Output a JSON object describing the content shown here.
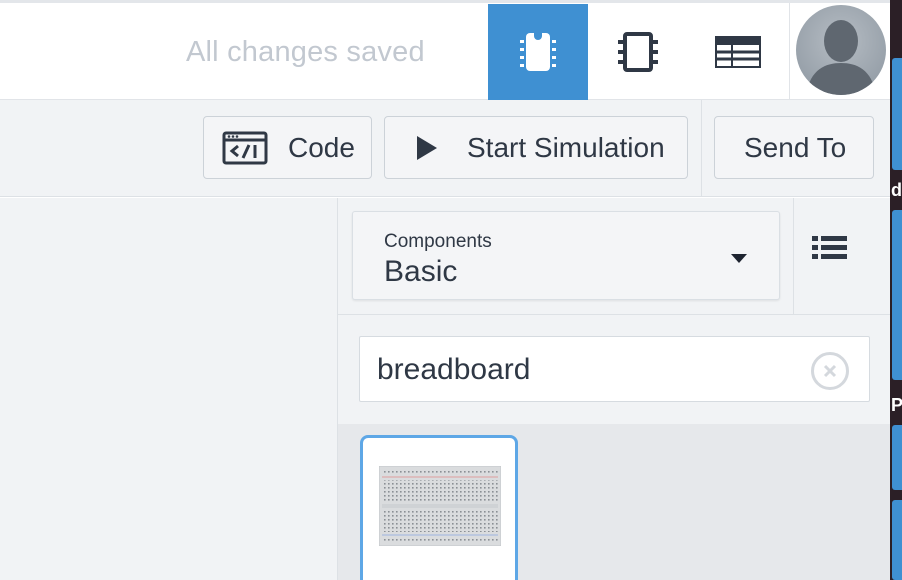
{
  "header": {
    "save_status": "All changes saved",
    "views": [
      {
        "name": "circuit-view",
        "icon": "breadboard-icon",
        "active": true
      },
      {
        "name": "schematic-view",
        "icon": "chip-icon",
        "active": false
      },
      {
        "name": "component-list-view",
        "icon": "table-icon",
        "active": false
      }
    ],
    "avatar": "user-avatar"
  },
  "toolbar": {
    "code_label": "Code",
    "simulation_label": "Start Simulation",
    "send_to_label": "Send To"
  },
  "components_panel": {
    "dropdown_label": "Components",
    "dropdown_value": "Basic",
    "search_value": "breadboard",
    "results": [
      {
        "name": "breadboard",
        "icon": "breadboard-thumbnail"
      }
    ]
  },
  "edge_strip": {
    "partial_text_1": "d",
    "partial_text_2": "PT"
  },
  "colors": {
    "accent": "#3f90d2",
    "selected_border": "#5ea7e6",
    "muted_text": "#c2c8d0",
    "panel_bg": "#f1f3f5"
  }
}
